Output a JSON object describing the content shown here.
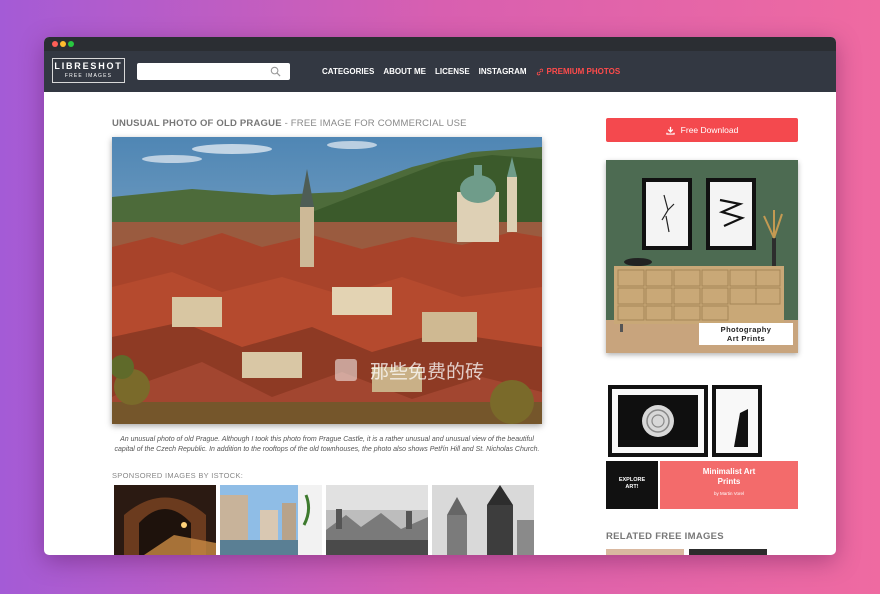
{
  "header": {
    "logo_line1": "LIBRESHOT",
    "logo_line2": "FREE IMAGES",
    "search_placeholder": "",
    "nav": [
      {
        "label": "CATEGORIES"
      },
      {
        "label": "ABOUT ME"
      },
      {
        "label": "LICENSE"
      },
      {
        "label": "INSTAGRAM"
      },
      {
        "label": "PREMIUM PHOTOS"
      }
    ]
  },
  "main": {
    "title": "UNUSUAL PHOTO OF OLD PRAGUE",
    "title_sub": " - FREE IMAGE FOR COMMERCIAL USE",
    "watermark": "那些免费的砖",
    "caption": "An unusual photo of old Prague. Although I took this photo from Prague Castle, it is a rather unusual and unusual view of the beautiful capital of the Czech Republic. In addition to the rooftops of the old townhouses, the photo also shows Petřín Hill and St. Nicholas Church.",
    "sponsored_label": "SPONSORED IMAGES BY ISTOCK:"
  },
  "sidebar": {
    "download_label": "Free Download",
    "ad1_label_line1": "Photography",
    "ad1_label_line2": "Art Prints",
    "ad2_explore_line1": "EXPLORE",
    "ad2_explore_line2": "ART!",
    "ad2_title_line1": "Minimalist Art",
    "ad2_title_line2": "Prints",
    "ad2_byline": "by Martin Vorel",
    "related_title": "RELATED FREE IMAGES"
  },
  "colors": {
    "navbar": "#333842",
    "accent_red": "#f4494e",
    "premium": "#ff4b4b",
    "ad_pink": "#f36b6b"
  },
  "icons": [
    "search-icon",
    "link-icon",
    "download-icon"
  ]
}
